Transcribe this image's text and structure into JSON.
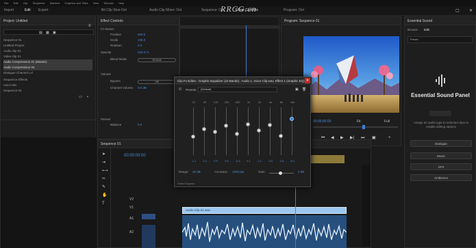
{
  "menubar": {
    "items": [
      "File",
      "Edit",
      "Clip",
      "Sequence",
      "Markers",
      "Graphics and Titles",
      "View",
      "Window",
      "Help"
    ]
  },
  "workspace_tabs": {
    "left": [
      "Import",
      "Edit",
      "Export"
    ],
    "right": [
      "Bit Clip Stoo Ool",
      "Audio Clip Mixer: Ool",
      "Sequence: Ool",
      "Effect Controls",
      "Program: Ool"
    ]
  },
  "watermark": "RRCG.cn",
  "project": {
    "title": "Project: Untitled",
    "items": [
      "Sequence 01",
      "Untitled Project",
      "Audio clip 01",
      "Video clip 01",
      "Audio Compression 01 (Master)",
      "Audio Compression 02",
      "Dialogue Channel Lvl",
      "Sequence Effects",
      "Voice Mix",
      "Sequence 02"
    ],
    "selected": [
      4,
      5
    ]
  },
  "effects": {
    "title": "Effect Controls",
    "rows": [
      "Fx Motion",
      "Position",
      "Scale",
      "Rotation",
      "Opacity",
      "Blend Mode",
      "Volume",
      "Bypass",
      "Channel Volume",
      "Panner",
      "Balance"
    ],
    "values": [
      "500.0",
      "100.0",
      "0.0",
      "100.0 %",
      "Normal",
      "0.0 dB",
      "Off",
      "0.0"
    ]
  },
  "program": {
    "title": "Program: Sequence 01",
    "timecode": "00:00:00:00",
    "fit": "Fit",
    "full": "Full"
  },
  "timeline": {
    "title": "Sequence 01",
    "timecode": "00:00:00:00",
    "tracks": [
      "V2",
      "V1",
      "A1",
      "A2"
    ],
    "clip_label": "Audio Clip 01.wav",
    "track_label": "Audio"
  },
  "eq_dialog": {
    "title": "Clip Fx Editor - Graphic Equalizer (10 Bands) : Audio 1, Voice Clip.wav, Effect 1 (Graphic EQ)",
    "presets_label": "Presets:",
    "preset_value": "(Default)",
    "bands": [
      "31",
      "63",
      "125",
      "250",
      "500",
      "1k",
      "2k",
      "4k",
      "8k",
      "16k"
    ],
    "band_values": [
      "-1.1",
      "2.4",
      "0.9",
      "3.5",
      "-0.3",
      "4.1",
      "1.2",
      "3.8",
      "-2.6",
      "6.0"
    ],
    "range_label": "Range:",
    "range_value": "20 dB",
    "accuracy_label": "Accuracy:",
    "accuracy_value": "1000 pts",
    "gain_label": "Gain:",
    "gain_value": "0 dB",
    "footer": "Select Bypass",
    "levels": [
      0.62,
      0.45,
      0.52,
      0.38,
      0.55,
      0.36,
      0.49,
      0.37,
      0.6,
      0.24
    ]
  },
  "essential_sound": {
    "title": "Essential Sound",
    "tabs": [
      "Browse",
      "Edit"
    ],
    "preset": "Preset",
    "panel_title": "Essential Sound Panel",
    "description": "Assign an audio type to selected clips to enable editing options",
    "buttons": [
      "Dialogue",
      "Music",
      "SFX",
      "Ambience"
    ]
  }
}
